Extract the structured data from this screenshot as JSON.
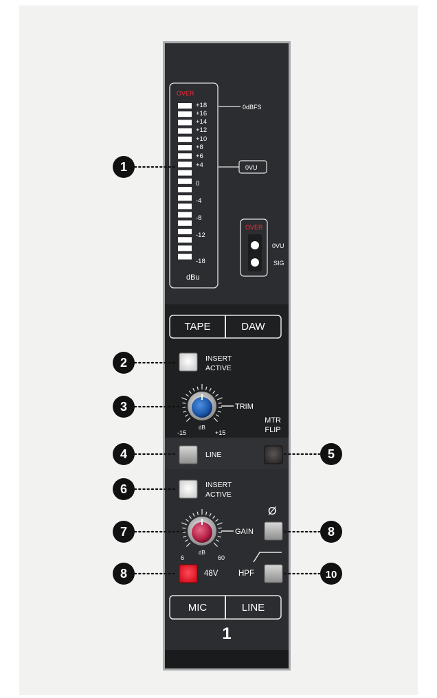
{
  "meter": {
    "over_label": "OVER",
    "scale": [
      "+18",
      "+16",
      "+14",
      "+12",
      "+10",
      "+8",
      "+6",
      "+4",
      "0",
      "-4",
      "-8",
      "-12",
      "-18"
    ],
    "unit": "dBu",
    "odbfs_label": "0dBFS",
    "ovu_tag": "0VU",
    "indicator": {
      "over_label": "OVER",
      "ovu_label": "0VU",
      "sig_label": "SIG"
    }
  },
  "monitor_source": {
    "tape_label": "TAPE",
    "daw_label": "DAW"
  },
  "upper": {
    "insert_label": [
      "INSERT",
      "ACTIVE"
    ],
    "trim": {
      "label": "TRIM",
      "min": "-15",
      "max": "+15",
      "unit": "dB"
    },
    "mtr_flip_label": [
      "MTR",
      "FLIP"
    ],
    "line_label": "LINE"
  },
  "lower": {
    "insert_label": [
      "INSERT",
      "ACTIVE"
    ],
    "gain": {
      "label": "GAIN",
      "min": "6",
      "max": "60",
      "unit": "dB"
    },
    "phase_symbol": "Ø",
    "phantom_label": "48V",
    "hpf_label": "HPF"
  },
  "input_select": {
    "mic_label": "MIC",
    "line_label": "LINE"
  },
  "channel_number": "1",
  "callouts": [
    "1",
    "2",
    "3",
    "4",
    "5",
    "6",
    "7",
    "8",
    "8",
    "10"
  ],
  "colors": {
    "background": "#f2f2f0",
    "strip": "#2b2d30",
    "led_on": "#ffffff",
    "over": "#ff2d3a",
    "trim_knob": "#1e5cb0",
    "gain_knob": "#c0224a",
    "phantom_on": "#e8142c"
  }
}
